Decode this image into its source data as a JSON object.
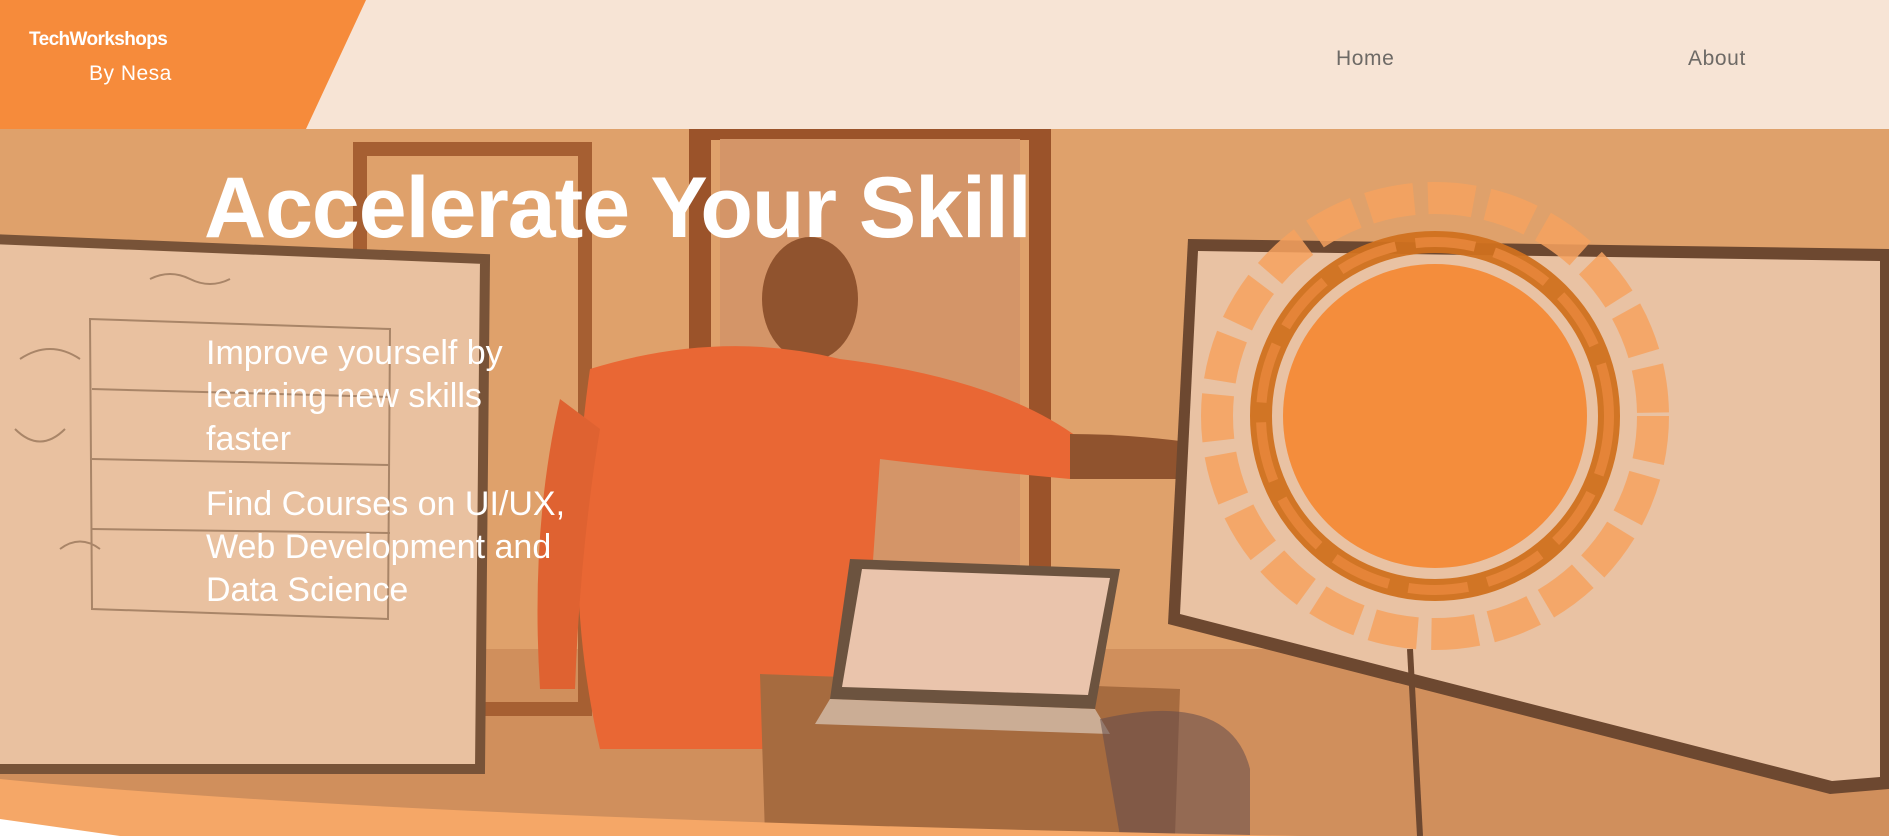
{
  "logo": {
    "title": "TechWorkshops",
    "subtitle": "By Nesa"
  },
  "nav": {
    "home": "Home",
    "about": "About"
  },
  "hero": {
    "title": "Accelerate Your Skill",
    "paragraph1": "Improve yourself by learning new skills faster",
    "paragraph2": "Find Courses on UI/UX, Web Development and Data Science"
  },
  "colors": {
    "brand_orange": "#f68b3b",
    "header_bg": "#f7e4d5",
    "nav_text": "#6e6a66",
    "hero_text": "#ffffff"
  }
}
